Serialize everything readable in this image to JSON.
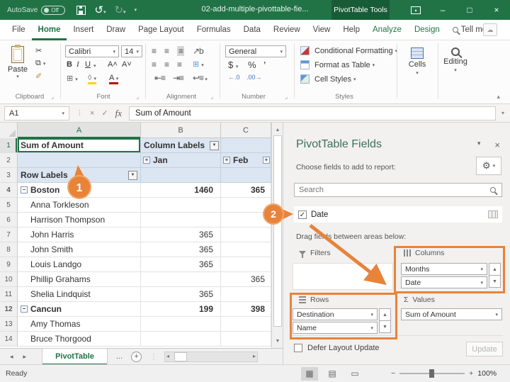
{
  "colors": {
    "excel_green": "#217346",
    "dark_green": "#185c37",
    "orange": "#e8833a",
    "pivot_header_blue": "#dce6f2"
  },
  "icons": {
    "save": "save",
    "undo": "↺",
    "redo": "↻",
    "caret_down": "▾",
    "caret_up": "▴",
    "close": "×",
    "minimize": "–",
    "maximize": "□",
    "check": "✓",
    "scissors": "✂",
    "copy": "⧉",
    "brush": "✐",
    "borders": "⊞",
    "fill_shape": "◊",
    "font_color_letter": "A",
    "grow_font": "A˄",
    "shrink_font": "A˅",
    "align_lines": "≡",
    "dollar": "$",
    "percent": "%",
    "comma": "’",
    "inc_dec": "←.0",
    "dec_dec": ".00→",
    "sigma": "Σ",
    "gear": "⚙",
    "x_mark": "×",
    "up": "▲",
    "down": "▼",
    "left": "◂",
    "right": "▸",
    "ellipsis": "...",
    "plus": "+",
    "minus": "−",
    "dots_v": "⋮",
    "view_normal": "▦",
    "view_layout": "▤",
    "view_break": "▭"
  },
  "titlebar": {
    "autosave_label": "AutoSave",
    "autosave_state": "Off",
    "filename": "02-add-multiple-pivottable-fie...",
    "context_title": "PivotTable Tools"
  },
  "ribbon_tabs": [
    {
      "label": "File",
      "active": false,
      "contextual": false,
      "search": false
    },
    {
      "label": "Home",
      "active": true,
      "contextual": false,
      "search": false
    },
    {
      "label": "Insert",
      "active": false,
      "contextual": false,
      "search": false
    },
    {
      "label": "Draw",
      "active": false,
      "contextual": false,
      "search": false
    },
    {
      "label": "Page Layout",
      "active": false,
      "contextual": false,
      "search": false
    },
    {
      "label": "Formulas",
      "active": false,
      "contextual": false,
      "search": false
    },
    {
      "label": "Data",
      "active": false,
      "contextual": false,
      "search": false
    },
    {
      "label": "Review",
      "active": false,
      "contextual": false,
      "search": false
    },
    {
      "label": "View",
      "active": false,
      "contextual": false,
      "search": false
    },
    {
      "label": "Help",
      "active": false,
      "contextual": false,
      "search": false
    },
    {
      "label": "Analyze",
      "active": false,
      "contextual": true,
      "search": false
    },
    {
      "label": "Design",
      "active": false,
      "contextual": true,
      "search": false
    },
    {
      "label": "Tell me",
      "active": false,
      "contextual": false,
      "search": true
    }
  ],
  "ribbon": {
    "paste_label": "Paste",
    "font_name": "Calibri",
    "font_size": "14",
    "bold": "B",
    "italic": "I",
    "underline": "U",
    "number_format": "General",
    "styles": [
      {
        "label": "Conditional Formatting"
      },
      {
        "label": "Format as Table"
      },
      {
        "label": "Cell Styles"
      }
    ],
    "cells_label": "Cells",
    "editing_label": "Editing",
    "groups": [
      "Clipboard",
      "Font",
      "Alignment",
      "Number",
      "Styles"
    ]
  },
  "formula_bar": {
    "cell_ref": "A1",
    "content": "Sum of Amount"
  },
  "grid": {
    "col_headers": [
      "A",
      "B",
      "C"
    ],
    "header_rows": {
      "r1": {
        "num": "1",
        "a": "Sum of Amount",
        "b": "Column Labels"
      },
      "r2": {
        "num": "2",
        "b": "Jan",
        "c": "Feb"
      },
      "r3": {
        "num": "3",
        "a": "Row Labels"
      }
    },
    "rows": [
      {
        "num": "4",
        "label": "Boston",
        "b": "1460",
        "c": "365",
        "bold": true,
        "collapse": true
      },
      {
        "num": "5",
        "label": "Anna Torkleson",
        "b": "",
        "c": "",
        "bold": false,
        "collapse": false
      },
      {
        "num": "6",
        "label": "Harrison Thompson",
        "b": "",
        "c": "",
        "bold": false,
        "collapse": false
      },
      {
        "num": "7",
        "label": "John Harris",
        "b": "365",
        "c": "",
        "bold": false,
        "collapse": false
      },
      {
        "num": "8",
        "label": "John Smith",
        "b": "365",
        "c": "",
        "bold": false,
        "collapse": false
      },
      {
        "num": "9",
        "label": "Louis Landgo",
        "b": "365",
        "c": "",
        "bold": false,
        "collapse": false
      },
      {
        "num": "10",
        "label": "Phillip Grahams",
        "b": "",
        "c": "365",
        "bold": false,
        "collapse": false
      },
      {
        "num": "11",
        "label": "Shelia Lindquist",
        "b": "365",
        "c": "",
        "bold": false,
        "collapse": false
      },
      {
        "num": "12",
        "label": "Cancun",
        "b": "199",
        "c": "398",
        "bold": true,
        "collapse": true
      },
      {
        "num": "13",
        "label": "Amy Thomas",
        "b": "",
        "c": "",
        "bold": false,
        "collapse": false
      },
      {
        "num": "14",
        "label": "Bruce Thorgood",
        "b": "",
        "c": "",
        "bold": false,
        "collapse": false
      }
    ]
  },
  "sheet_bar": {
    "active_tab": "PivotTable"
  },
  "status_bar": {
    "status": "Ready",
    "zoom": "100%"
  },
  "pane": {
    "title": "PivotTable Fields",
    "choose": "Choose fields to add to report:",
    "search_placeholder": "Search",
    "field": {
      "label": "Date",
      "checked": true
    },
    "drag_hint": "Drag fields between areas below:",
    "areas": {
      "filters": {
        "label": "Filters",
        "items": []
      },
      "columns": {
        "label": "Columns",
        "items": [
          "Months",
          "Date"
        ]
      },
      "rows": {
        "label": "Rows",
        "items": [
          "Destination",
          "Name"
        ]
      },
      "values": {
        "label": "Values",
        "items": [
          "Sum of Amount"
        ]
      }
    },
    "defer_label": "Defer Layout Update",
    "update_label": "Update"
  },
  "callouts": {
    "step1": "1",
    "step2": "2"
  }
}
